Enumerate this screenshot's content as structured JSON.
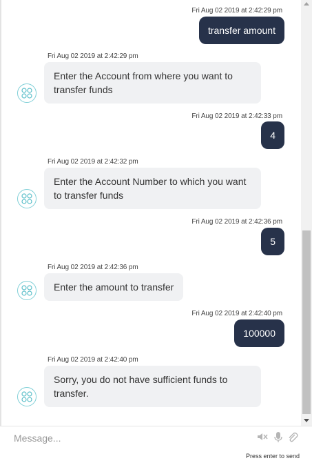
{
  "messages": [
    {
      "sender": "user",
      "time": "Fri Aug 02 2019 at 2:42:29 pm",
      "text": "transfer amount"
    },
    {
      "sender": "bot",
      "time": "Fri Aug 02 2019 at 2:42:29 pm",
      "text": "Enter the Account from where you want to transfer funds"
    },
    {
      "sender": "user",
      "time": "Fri Aug 02 2019 at 2:42:33 pm",
      "text": "4"
    },
    {
      "sender": "bot",
      "time": "Fri Aug 02 2019 at 2:42:32 pm",
      "text": "Enter the Account Number to which you want to transfer funds"
    },
    {
      "sender": "user",
      "time": "Fri Aug 02 2019 at 2:42:36 pm",
      "text": "5"
    },
    {
      "sender": "bot",
      "time": "Fri Aug 02 2019 at 2:42:36 pm",
      "text": "Enter the amount to transfer"
    },
    {
      "sender": "user",
      "time": "Fri Aug 02 2019 at 2:42:40 pm",
      "text": "100000"
    },
    {
      "sender": "bot",
      "time": "Fri Aug 02 2019 at 2:42:40 pm",
      "text": "Sorry, you do not have sufficient funds to transfer."
    }
  ],
  "composer": {
    "placeholder": "Message...",
    "hint": "Press enter to send",
    "icons": [
      "mute-speaker-icon",
      "microphone-icon",
      "attachment-icon"
    ]
  },
  "colors": {
    "user_bubble": "#27324a",
    "bot_bubble": "#f0f1f3",
    "avatar_accent": "#5bbfc9"
  }
}
